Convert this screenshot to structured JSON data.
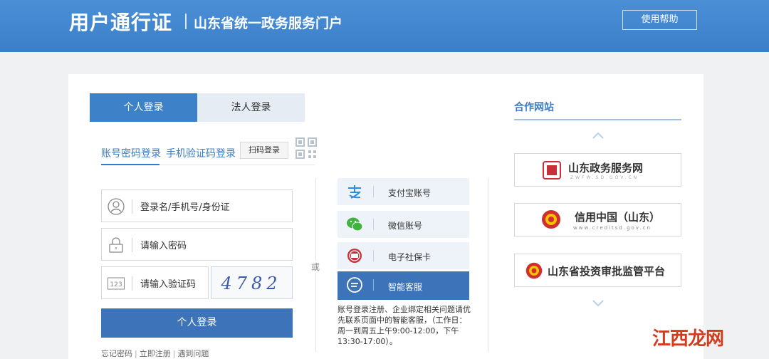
{
  "header": {
    "brand": "用户通行证",
    "subtitle": "山东省统一政务服务门户",
    "help_label": "使用帮助"
  },
  "tabs": {
    "personal": "个人登录",
    "legal": "法人登录"
  },
  "subtabs": {
    "account": "账号密码登录",
    "phone": "手机验证码登录",
    "scan": "扫码登录"
  },
  "form": {
    "username_placeholder": "登录名/手机号/身份证",
    "password_placeholder": "请输入密码",
    "code_placeholder": "请输入验证码",
    "code_icon_text": "123",
    "captcha_text": "4782",
    "login_button": "个人登录"
  },
  "links": {
    "forgot": "忘记密码",
    "register": "立即注册",
    "problem": "遇到问题"
  },
  "or_text": "或",
  "alt_logins": {
    "alipay": "支付宝账号",
    "wechat": "微信账号",
    "social": "电子社保卡",
    "service": "智能客服"
  },
  "service_note": "账号登录注册、企业绑定相关问题请优先联系页面中的智能客服，（工作日：周一到周五上午9:00-12:00，下午13:30-17:00）。",
  "partners": {
    "title": "合作网站",
    "items": [
      {
        "name": "山东政务服务网",
        "sub": "ZWFW.SD.GOV.CN"
      },
      {
        "name": "信用中国（山东）",
        "sub": "www.creditsd.gov.cn"
      },
      {
        "name": "山东省投资审批监管平台",
        "sub": ""
      }
    ]
  },
  "watermark": "江西龙网",
  "colors": {
    "header_blue": "#3b7fc9",
    "primary_button": "#3d73b9",
    "link_blue": "#3a7cc3"
  }
}
